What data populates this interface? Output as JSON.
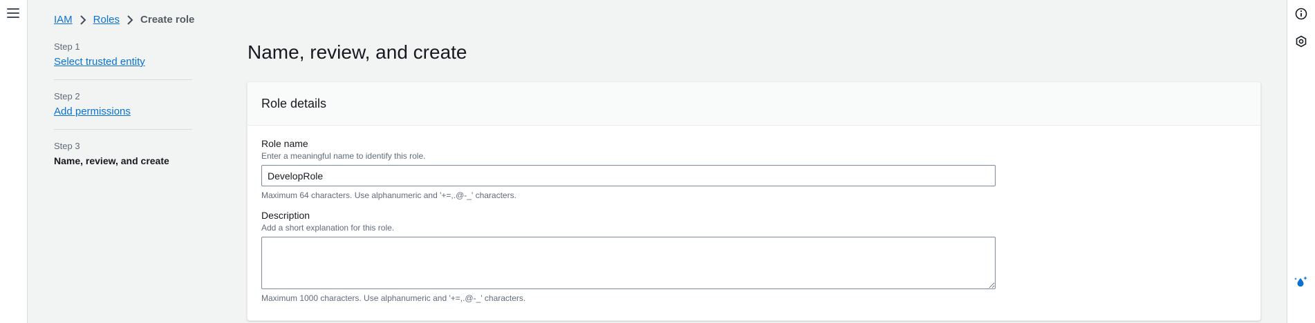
{
  "colors": {
    "link": "#0972d3",
    "background": "#f2f3f3",
    "border": "#d5dbdb"
  },
  "icons": {
    "menu": "hamburger-icon",
    "info": "info-icon",
    "settings": "hexagon-settings-icon",
    "assistant": "sparkle-droplet-icon"
  },
  "breadcrumb": {
    "items": [
      {
        "label": "IAM"
      },
      {
        "label": "Roles"
      }
    ],
    "current": "Create role"
  },
  "steps": [
    {
      "number": "Step 1",
      "label": "Select trusted entity"
    },
    {
      "number": "Step 2",
      "label": "Add permissions"
    },
    {
      "number": "Step 3",
      "label": "Name, review, and create"
    }
  ],
  "page": {
    "title": "Name, review, and create"
  },
  "role_details": {
    "heading": "Role details",
    "role_name": {
      "label": "Role name",
      "description": "Enter a meaningful name to identify this role.",
      "value": "DevelopRole",
      "hint": "Maximum 64 characters. Use alphanumeric and '+=,.@-_' characters."
    },
    "description": {
      "label": "Description",
      "description": "Add a short explanation for this role.",
      "value": "",
      "hint": "Maximum 1000 characters. Use alphanumeric and '+=,.@-_' characters."
    }
  }
}
